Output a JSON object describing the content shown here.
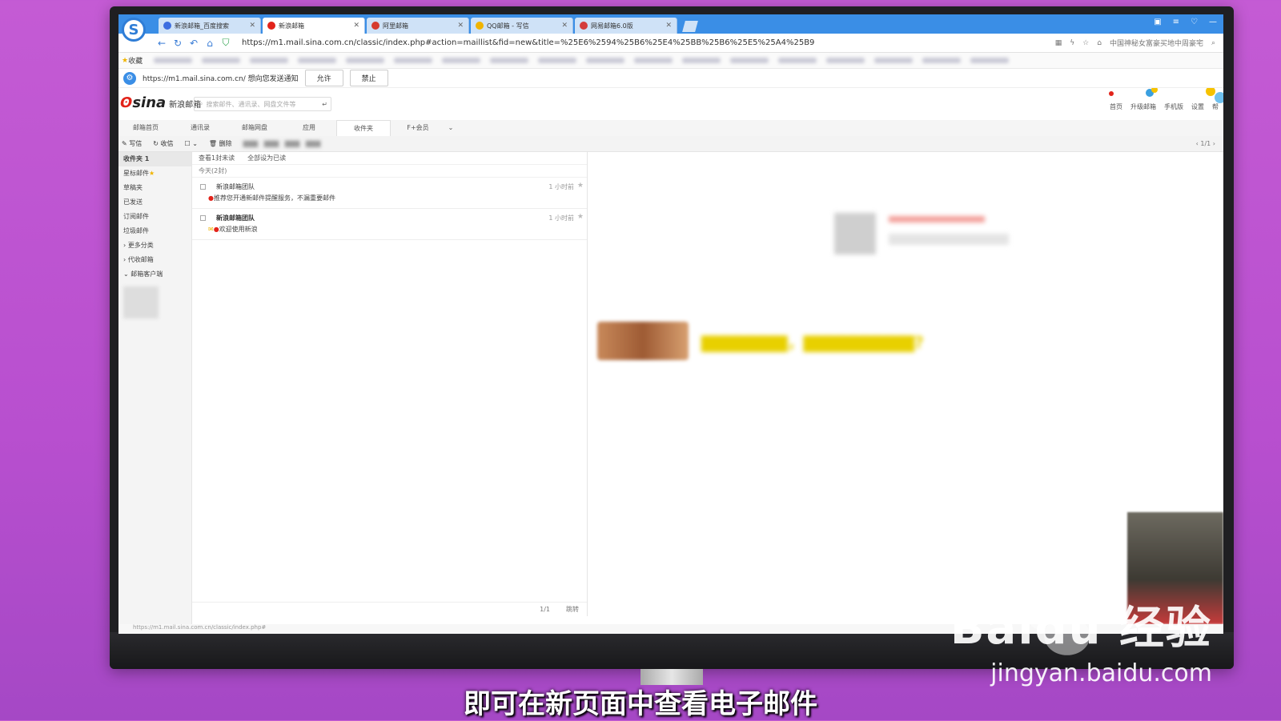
{
  "browser": {
    "tabs": [
      {
        "label": "新浪邮箱_百度搜索",
        "active": false,
        "icon": "baidu-icon"
      },
      {
        "label": "新浪邮箱",
        "active": true,
        "icon": "sina-icon"
      },
      {
        "label": "阿里邮箱",
        "active": false,
        "icon": "ali-mail-icon"
      },
      {
        "label": "QQ邮箱 - 写信",
        "active": false,
        "icon": "qq-mail-icon"
      },
      {
        "label": "网易邮箱6.0版",
        "active": false,
        "icon": "netease-icon"
      }
    ],
    "url": "https://m1.mail.sina.com.cn/classic/index.php#action=maillist&fid=new&title=%25E6%2594%25B6%25E4%25BB%25B6%25E5%25A4%25B9",
    "favorites_label": "收藏",
    "right_hint": "中国神秘女富豪买地中周豪宅",
    "notification": {
      "text": "https://m1.mail.sina.com.cn/ 想向您发送通知",
      "allow": "允许",
      "deny": "禁止"
    },
    "status_url": "https://m1.mail.sina.com.cn/classic/index.php#"
  },
  "mail": {
    "logo": "sina",
    "logo_sub": "新浪邮箱",
    "search_placeholder": "搜索邮件、通讯录、网盘文件等",
    "header_links": [
      "首页",
      "升级邮箱",
      "手机版",
      "设置",
      "帮"
    ],
    "tabs": [
      "邮箱首页",
      "通讯录",
      "邮箱网盘",
      "应用",
      "收件夹",
      "F+会员"
    ],
    "toolbar": {
      "compose": "写信",
      "receive": "收信",
      "delete": "删除",
      "pager": "1/1"
    },
    "sidebar": [
      "收件夹 1",
      "星标邮件",
      "草稿夹",
      "已发送",
      "订阅邮件",
      "垃圾邮件",
      "更多分类",
      "代收邮箱",
      "邮箱客户端"
    ],
    "list_actions": [
      "查看1封未读",
      "全部设为已读"
    ],
    "group_label": "今天(2封)",
    "messages": [
      {
        "from": "新浪邮箱团队",
        "subject": "推荐您开通新邮件提醒服务，不漏重要邮件",
        "time": "1 小时前",
        "unread": false
      },
      {
        "from": "新浪邮箱团队",
        "subject": "欢迎使用新浪",
        "time": "1 小时前",
        "unread": true
      }
    ],
    "list_footer": [
      "1/1",
      "跳转"
    ]
  },
  "overlay": {
    "watermark": "Bai",
    "watermark_du": "du",
    "watermark_suffix": "经验",
    "watermark_url": "jingyan.baidu.com",
    "subtitle": "即可在新页面中查看电子邮件"
  },
  "colors": {
    "tabbar": "#3a8ee6",
    "sina_red": "#e2231a",
    "background": "#c45bd4"
  }
}
